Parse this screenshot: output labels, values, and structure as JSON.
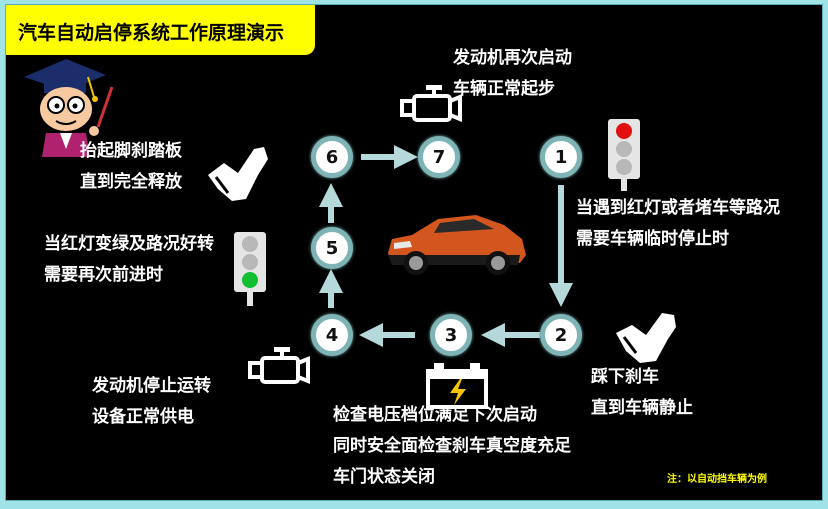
{
  "title": "汽车自动启停系统工作原理演示",
  "steps": [
    {
      "num": "1",
      "lines": [
        "当遇到红灯或者堵车等路况",
        "需要车辆临时停止时"
      ]
    },
    {
      "num": "2",
      "lines": [
        "踩下刹车",
        "直到车辆静止"
      ]
    },
    {
      "num": "3",
      "lines": [
        "检查电压档位满足下次启动",
        "同时安全面检查刹车真空度充足",
        "车门状态关闭"
      ]
    },
    {
      "num": "4",
      "lines": [
        "发动机停止运转",
        "设备正常供电"
      ]
    },
    {
      "num": "5",
      "lines": [
        "当红灯变绿及路况好转",
        "需要再次前进时"
      ]
    },
    {
      "num": "6",
      "lines": [
        "抬起脚刹踏板",
        "直到完全释放"
      ]
    },
    {
      "num": "7",
      "lines": [
        "发动机再次启动",
        "车辆正常起步"
      ]
    }
  ],
  "note": "注：以自动挡车辆为例",
  "icons": [
    "teacher-mascot",
    "engine-icon",
    "traffic-light-red-icon",
    "traffic-light-green-icon",
    "brake-pedal-icon",
    "battery-icon",
    "car-image"
  ],
  "colors": {
    "background": "#000000",
    "title_bg": "#ffff00",
    "circle_border": "#7fb4b6",
    "arrow": "#b5d9db",
    "note": "#ffff00",
    "outer_bg": "#9fe3e6"
  }
}
